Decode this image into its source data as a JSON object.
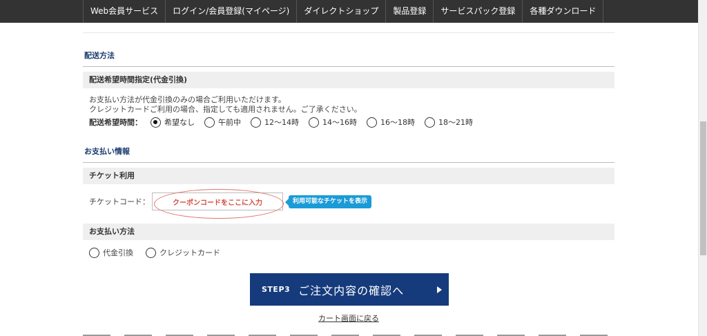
{
  "nav": {
    "items": [
      "Web会員サービス",
      "ログイン/会員登録(マイページ)",
      "ダイレクトショップ",
      "製品登録",
      "サービスパック登録",
      "各種ダウンロード"
    ]
  },
  "shipping": {
    "title": "配送方法",
    "time_bar": "配送希望時間指定(代金引換)",
    "note1": "お支払い方法が代金引換のみの場合ご利用いただけます。",
    "note2": "クレジットカードご利用の場合、指定しても適用されません。ご了承ください。",
    "time_label": "配送希望時間：",
    "options": [
      "希望なし",
      "午前中",
      "12〜14時",
      "14〜16時",
      "16〜18時",
      "18〜21時"
    ],
    "selected": "希望なし"
  },
  "payment_info": {
    "title": "お支払い情報",
    "ticket_bar": "チケット利用",
    "ticket_label": "チケットコード：",
    "ticket_placeholder": "クーポンコードをここに入力",
    "ticket_button": "利用可能なチケットを表示",
    "method_bar": "お支払い方法",
    "methods": [
      "代金引換",
      "クレジットカード"
    ]
  },
  "actions": {
    "step_label": "STEP3",
    "step_text": "ご注文内容の確認へ",
    "back_link": "カート画面に戻る"
  },
  "colors": {
    "nav_bg": "#333333",
    "section_title": "#1a3a6e",
    "step_button": "#163b7c",
    "ticket_button": "#1a9bd7",
    "highlight": "#e0736a"
  }
}
